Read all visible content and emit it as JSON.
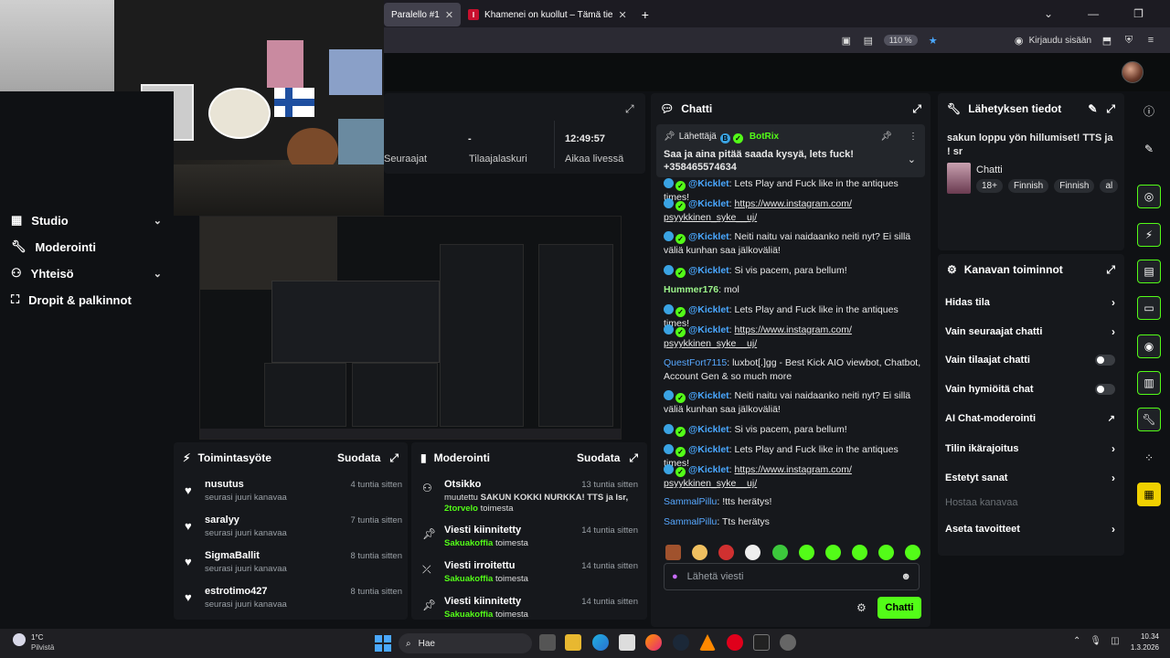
{
  "browser": {
    "tabs": [
      {
        "title": "Paralello #1",
        "active": true
      },
      {
        "title": "Khamenei on kuollut – Tämä tie",
        "active": false
      }
    ],
    "zoom": "110 %",
    "login_label": "Kirjaudu sisään"
  },
  "sidebar": {
    "items": [
      {
        "label": "Studio",
        "icon": "studio-icon",
        "expandable": true
      },
      {
        "label": "Moderointi",
        "icon": "wrench-icon",
        "expandable": false
      },
      {
        "label": "Yhteisö",
        "icon": "community-icon",
        "expandable": true
      },
      {
        "label": "Dropit & palkinnot",
        "icon": "gift-icon",
        "expandable": false
      }
    ]
  },
  "stats": {
    "followers_label": "Seuraajat",
    "subs_value": "-",
    "subs_label": "Tilaajalaskuri",
    "time_value": "12:49:57",
    "time_label": "Aikaa livessä"
  },
  "chat": {
    "title": "Chatti",
    "pinned": {
      "sender_label": "Lähettäjä",
      "sender": "BotRix",
      "text": "Saa ja aina pitää saada kysyä, lets fuck! +358465574634"
    },
    "messages": [
      {
        "user": "@Kicklet",
        "type": "bot",
        "text": ": Lets Play and Fuck like in the antiques times!"
      },
      {
        "user": "@Kicklet",
        "type": "bot",
        "text": ": ",
        "link": "https://www.instagram.com/ psyykkinen_syke__uj/"
      },
      {
        "user": "@Kicklet",
        "type": "bot",
        "text": ": Neiti naitu vai naidaanko neiti nyt? Ei sillä väliä kunhan saa jälkoväliä!"
      },
      {
        "user": "@Kicklet",
        "type": "bot",
        "text": ": Si vis pacem, para bellum!"
      },
      {
        "user": "Hummer176",
        "type": "green",
        "text": ": mol"
      },
      {
        "user": "@Kicklet",
        "type": "bot",
        "text": ": Lets Play and Fuck like in the antiques times!"
      },
      {
        "user": "@Kicklet",
        "type": "bot",
        "text": ": ",
        "link": "https://www.instagram.com/ psyykkinen_syke__uj/"
      },
      {
        "user": "QuestFort7115",
        "type": "blue",
        "text": ": luxbot[.]gg - Best Kick AIO viewbot, Chatbot, Account Gen & so much more"
      },
      {
        "user": "@Kicklet",
        "type": "bot",
        "text": ": Neiti naitu vai naidaanko neiti nyt? Ei sillä väliä kunhan saa jälkoväliä!"
      },
      {
        "user": "@Kicklet",
        "type": "bot",
        "text": ": Si vis pacem, para bellum!"
      },
      {
        "user": "@Kicklet",
        "type": "bot",
        "text": ": Lets Play and Fuck like in the antiques times!"
      },
      {
        "user": "@Kicklet",
        "type": "bot",
        "text": ": ",
        "link": "https://www.instagram.com/ psyykkinen_syke__uj/"
      },
      {
        "user": "SammalPillu",
        "type": "blue",
        "text": ": !tts herätys!"
      },
      {
        "user": "SammalPillu",
        "type": "blue",
        "text": ": Tts herätys"
      }
    ],
    "input_placeholder": "Lähetä viesti",
    "send_label": "Chatti"
  },
  "stream_info": {
    "title": "Lähetyksen tiedot",
    "stream_title": "sakun loppu yön hillumiset! TTS ja ! sr",
    "category": "Chatti",
    "tags": [
      "18+",
      "Finnish",
      "Finnish",
      "al"
    ]
  },
  "channel_actions": {
    "title": "Kanavan toiminnot",
    "items": [
      {
        "label": "Hidas tila",
        "control": "arrow"
      },
      {
        "label": "Vain seuraajat chatti",
        "control": "arrow"
      },
      {
        "label": "Vain tilaajat chatti",
        "control": "toggle"
      },
      {
        "label": "Vain hymiöitä chat",
        "control": "toggle"
      },
      {
        "label": "AI Chat-moderointi",
        "control": "external"
      },
      {
        "label": "Tilin ikärajoitus",
        "control": "arrow"
      },
      {
        "label": "Estetyt sanat",
        "control": "arrow"
      },
      {
        "label": "Hostaa kanavaa",
        "control": "none",
        "disabled": true
      },
      {
        "label": "Aseta tavoitteet",
        "control": "arrow"
      }
    ]
  },
  "activity": {
    "title": "Toimintasyöte",
    "filter": "Suodata",
    "items": [
      {
        "user": "nusutus",
        "action": "seurasi juuri kanavaa",
        "time": "4 tuntia sitten"
      },
      {
        "user": "saralyy",
        "action": "seurasi juuri kanavaa",
        "time": "7 tuntia sitten"
      },
      {
        "user": "SigmaBallit",
        "action": "seurasi juuri kanavaa",
        "time": "8 tuntia sitten"
      },
      {
        "user": "estrotimo427",
        "action": "seurasi juuri kanavaa",
        "time": "8 tuntia sitten"
      }
    ]
  },
  "moderation": {
    "title": "Moderointi",
    "filter": "Suodata",
    "items": [
      {
        "title": "Otsikko",
        "detail_prefix": "muutettu ",
        "detail_bold": "SAKUN KOKKI NURKKA! TTS ja lsr,",
        "actor": "2torvelo",
        "actor_suffix": " toimesta",
        "time": "13 tuntia sitten",
        "icon": "user-edit-icon"
      },
      {
        "title": "Viesti kiinnitetty",
        "actor": "Sakuakoffia",
        "actor_suffix": " toimesta",
        "time": "14 tuntia sitten",
        "icon": "pin-icon"
      },
      {
        "title": "Viesti irroitettu",
        "actor": "Sakuakoffia",
        "actor_suffix": " toimesta",
        "time": "14 tuntia sitten",
        "icon": "unpin-icon"
      },
      {
        "title": "Viesti kiinnitetty",
        "actor": "Sakuakoffia",
        "actor_suffix": " toimesta",
        "time": "14 tuntia sitten",
        "icon": "pin-icon"
      }
    ]
  },
  "taskbar": {
    "weather_temp": "1°C",
    "weather_desc": "Pilvistä",
    "search_placeholder": "Hae",
    "time": "10.34",
    "date": "1.3.2026"
  },
  "colors": {
    "accent": "#53fc18",
    "panel": "#16181c",
    "background": "#0f1114"
  }
}
